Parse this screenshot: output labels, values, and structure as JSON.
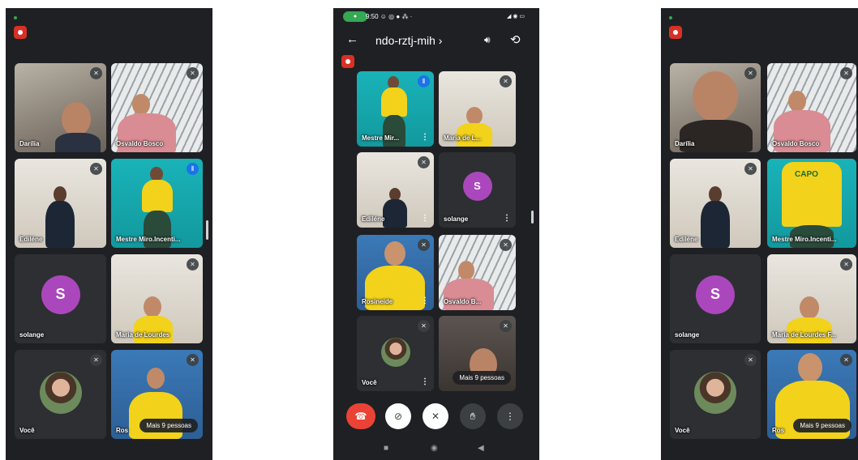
{
  "screens": [
    {
      "tiles": [
        {
          "name": "Darília"
        },
        {
          "name": "Osvaldo Bosco"
        },
        {
          "name": "Ediléne"
        },
        {
          "name": "Mestre Miro.Incenti..."
        },
        {
          "name": "solange",
          "avatar_letter": "S"
        },
        {
          "name": "Maria de Lourdes"
        },
        {
          "name": "Você"
        },
        {
          "name": "Ros"
        }
      ],
      "more_people_label": "Mais 9 pessoas"
    },
    {
      "status_bar": {
        "pill": "●",
        "time": "9:50 ☺ ◎ ● ⁂ ·",
        "icons": "◢ ◉ ▭"
      },
      "meeting_code": "ndo-rztj-mih ›",
      "tiles": [
        {
          "name": "Mestre Mir..."
        },
        {
          "name": "Maria de L..."
        },
        {
          "name": "Ediléne"
        },
        {
          "name": "solange",
          "avatar_letter": "S"
        },
        {
          "name": "Rosineide"
        },
        {
          "name": "Osvaldo B..."
        },
        {
          "name": "Você"
        },
        {
          "name": ""
        }
      ],
      "more_people_label": "Mais 9 pessoas",
      "controls": [
        {
          "icon": "end-call-icon"
        },
        {
          "icon": "camera-off-icon"
        },
        {
          "icon": "mic-off-icon"
        },
        {
          "icon": "raise-hand-icon"
        },
        {
          "icon": "more-options-icon"
        }
      ],
      "nav": [
        "■",
        "◉",
        "◀"
      ]
    },
    {
      "tiles": [
        {
          "name": "Darília"
        },
        {
          "name": "Osvaldo Bosco"
        },
        {
          "name": "Ediléne"
        },
        {
          "name": "Mestre Miro.Incenti..."
        },
        {
          "name": "solange",
          "avatar_letter": "S"
        },
        {
          "name": "Maria de Lourdes F..."
        },
        {
          "name": "Você"
        },
        {
          "name": "Ros"
        }
      ],
      "more_people_label": "Mais 9 pessoas",
      "shirt_text": "CAPO"
    }
  ],
  "colors": {
    "end_call": "#ea4335",
    "avatar": "#ab47bc",
    "recording": "#d93025",
    "speaking": "#1a73e8"
  }
}
